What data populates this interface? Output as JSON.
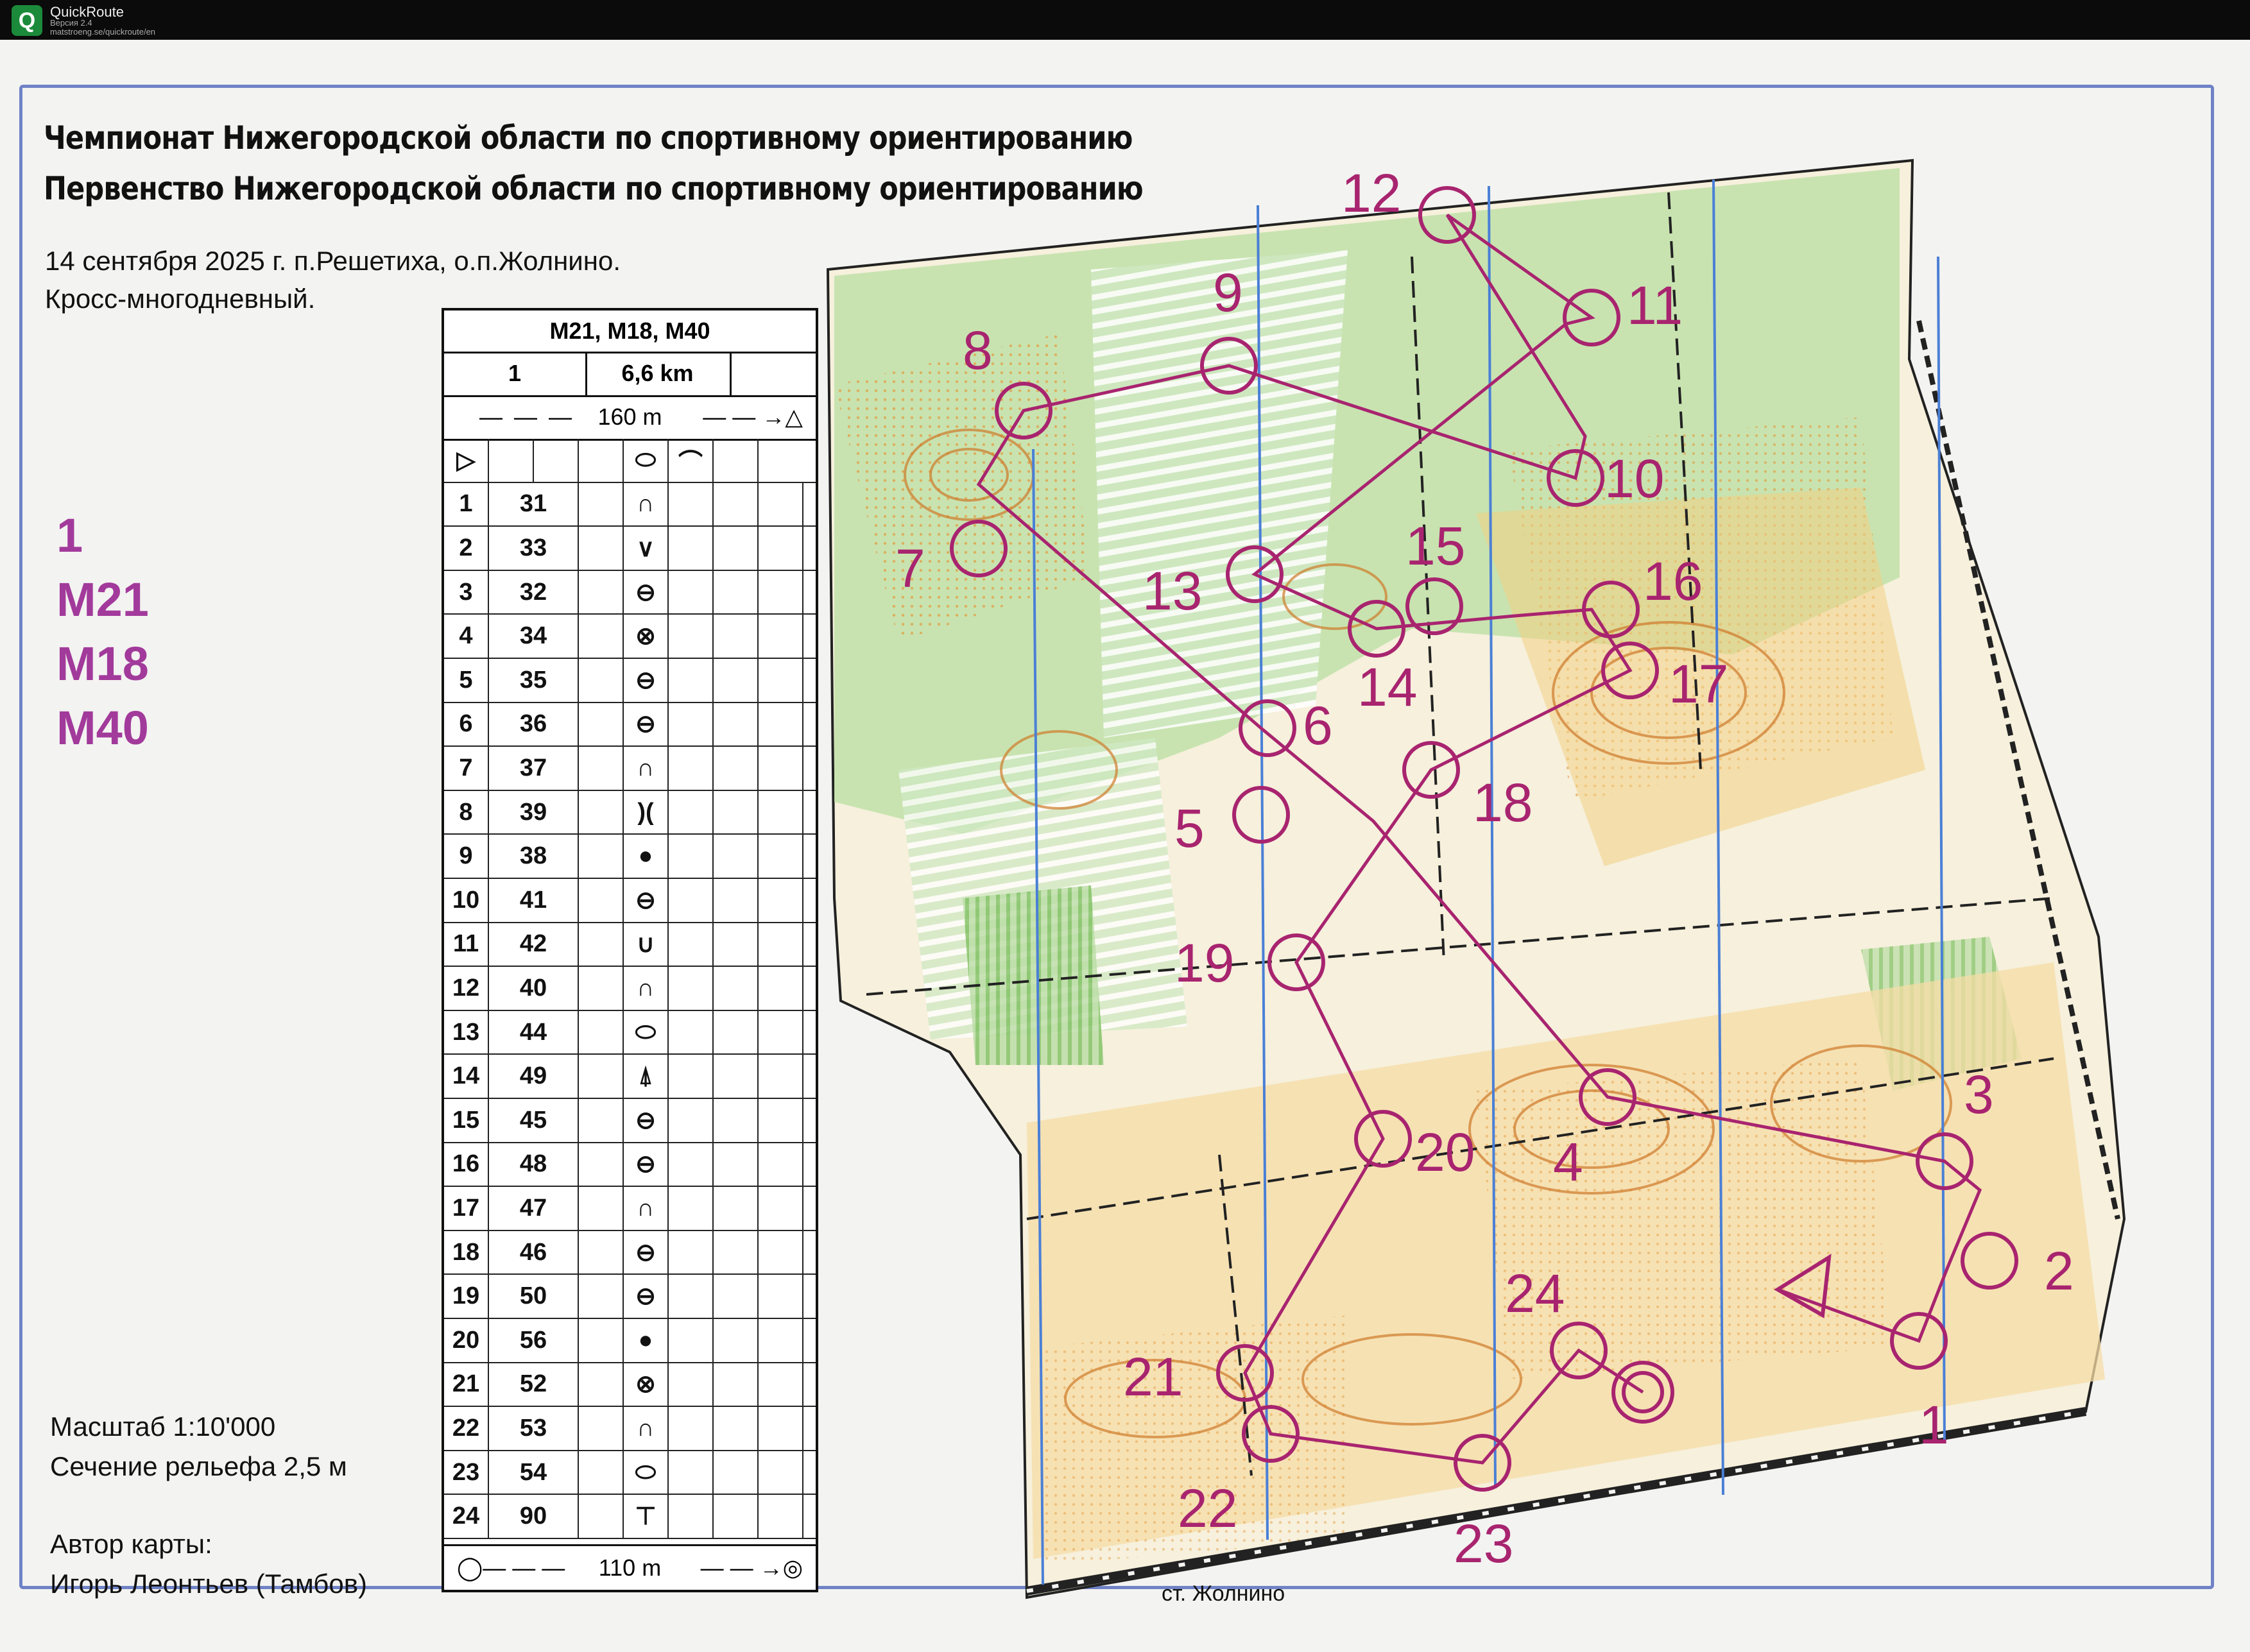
{
  "app": {
    "name": "QuickRoute",
    "version": "Версия 2.4",
    "url": "matstroeng.se/quickroute/en",
    "icon": "quickroute-q-icon"
  },
  "header": {
    "title_line1": "Чемпионат Нижегородской области по спортивному ориентированию",
    "title_line2": "Первенство Нижегородской области по спортивному ориентированию",
    "date_place": "14 сентября 2025 г. п.Решетиха, о.п.Жолнино.",
    "format": "Кросс-многодневный."
  },
  "class_block": [
    "1",
    "M21",
    "M18",
    "M40"
  ],
  "legend": {
    "classes": "M21, M18, M40",
    "course": "1",
    "length": "6,6 km",
    "start_marking": "160 m",
    "finish_marking": "110 m",
    "controls": [
      {
        "n": "1",
        "code": "31"
      },
      {
        "n": "2",
        "code": "33"
      },
      {
        "n": "3",
        "code": "32"
      },
      {
        "n": "4",
        "code": "34"
      },
      {
        "n": "5",
        "code": "35"
      },
      {
        "n": "6",
        "code": "36"
      },
      {
        "n": "7",
        "code": "37"
      },
      {
        "n": "8",
        "code": "39"
      },
      {
        "n": "9",
        "code": "38"
      },
      {
        "n": "10",
        "code": "41"
      },
      {
        "n": "11",
        "code": "42"
      },
      {
        "n": "12",
        "code": "40"
      },
      {
        "n": "13",
        "code": "44"
      },
      {
        "n": "14",
        "code": "49"
      },
      {
        "n": "15",
        "code": "45"
      },
      {
        "n": "16",
        "code": "48"
      },
      {
        "n": "17",
        "code": "47"
      },
      {
        "n": "18",
        "code": "46"
      },
      {
        "n": "19",
        "code": "50"
      },
      {
        "n": "20",
        "code": "56"
      },
      {
        "n": "21",
        "code": "52"
      },
      {
        "n": "22",
        "code": "53"
      },
      {
        "n": "23",
        "code": "54"
      },
      {
        "n": "24",
        "code": "90"
      }
    ]
  },
  "footer": {
    "scale": "Масштаб 1:10'000",
    "contour": "Сечение рельефа 2,5 м",
    "author_label": "Автор карты:",
    "author_name": "Игорь Леонтьев (Тамбов)"
  },
  "station_label": "ст. Жолнино",
  "colors": {
    "course": "#a8246f",
    "forest_green": "#7fc36a",
    "open_yellow": "#f2b84b",
    "contour_brown": "#cf7a2a",
    "north_lines": "#4a7fd6",
    "class_text": "#a23a9b"
  }
}
